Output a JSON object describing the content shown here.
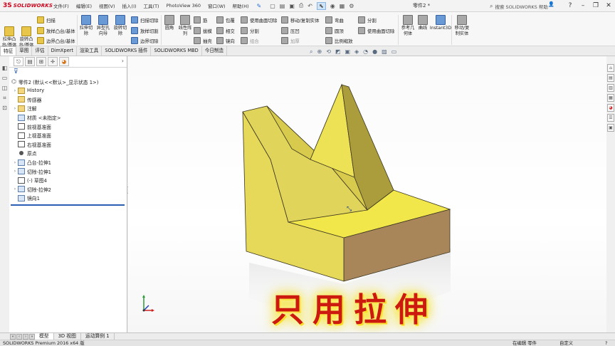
{
  "app": {
    "logo_mark": "3S",
    "logo_text": "SOLIDWORKS"
  },
  "menu": [
    "文件(F)",
    "编辑(E)",
    "视图(V)",
    "插入(I)",
    "工具(T)",
    "PhotoView 360",
    "窗口(W)",
    "帮助(H)"
  ],
  "document": {
    "title": "零件2 *"
  },
  "search": {
    "placeholder": "搜索 SOLIDWORKS 帮助"
  },
  "ribbon": {
    "extrude_boss": "拉伸凸台/基体",
    "revolve_boss": "旋转凸台/基体",
    "sweep": "扫描",
    "loft": "放样凸台/基体",
    "boundary": "边界凸台/基体",
    "extrude_cut": "拉伸切除",
    "hole_wizard": "异型孔向导",
    "revolve_cut": "旋转切除",
    "swept_cut": "扫描切除",
    "lofted_cut": "放样切割",
    "boundary_cut": "边界切除",
    "fillet": "圆角",
    "linear_pattern": "线性阵列",
    "rib": "筋",
    "draft": "拔模",
    "shell": "抽壳",
    "wrap": "包覆",
    "intersect": "相交",
    "mirror": "镜向",
    "use_surface_cut": "使用曲面切除",
    "split": "分割",
    "combine": "组合",
    "move_copy": "移动/复制实体",
    "indent": "压凹",
    "thicken": "加厚",
    "flex": "弯曲",
    "dome": "圆顶",
    "scale": "比例缩放",
    "split_line": "分割",
    "simple_hole": "简单直孔",
    "use_surface_cut2": "使用曲面切除",
    "ref_geometry": "参考几何体",
    "curves": "曲线",
    "instant3d": "Instant3D",
    "move_copy_body": "移动/复制实体"
  },
  "command_tabs": [
    "特征",
    "草图",
    "评估",
    "DimXpert",
    "渲染工具",
    "SOLIDWORKS 插件",
    "SOLIDWORKS MBD",
    "今日制造"
  ],
  "tree": {
    "root": "零件2 (默认<<默认>_显示状态 1>)",
    "items": [
      {
        "label": "History",
        "icon": "history-icon"
      },
      {
        "label": "传感器",
        "icon": "sensor-icon"
      },
      {
        "label": "注解",
        "icon": "annotation-icon"
      },
      {
        "label": "材质 <未指定>",
        "icon": "material-icon"
      },
      {
        "label": "前视基准面",
        "icon": "plane-icon"
      },
      {
        "label": "上视基准面",
        "icon": "plane-icon"
      },
      {
        "label": "右视基准面",
        "icon": "plane-icon"
      },
      {
        "label": "原点",
        "icon": "origin-icon"
      },
      {
        "label": "凸台-拉伸1",
        "icon": "extrude-icon"
      },
      {
        "label": "切除-拉伸1",
        "icon": "cut-extrude-icon"
      },
      {
        "label": "(-) 草图4",
        "icon": "sketch-icon"
      },
      {
        "label": "切除-拉伸2",
        "icon": "cut-extrude-icon"
      },
      {
        "label": "镜向1",
        "icon": "mirror-icon"
      }
    ]
  },
  "caption": "只用拉伸",
  "bottom_tabs": [
    "模型",
    "3D 视图",
    "运动算例 1"
  ],
  "status": {
    "version": "SOLIDWORKS Premium 2016 x64 版",
    "mode": "在编辑 零件",
    "units": "自定义",
    "help": "?"
  },
  "colors": {
    "model_face": "#e6d95a",
    "model_shadow": "#a89b3e",
    "caption": "#cc1a0f",
    "caption_glow": "#f6e300"
  }
}
